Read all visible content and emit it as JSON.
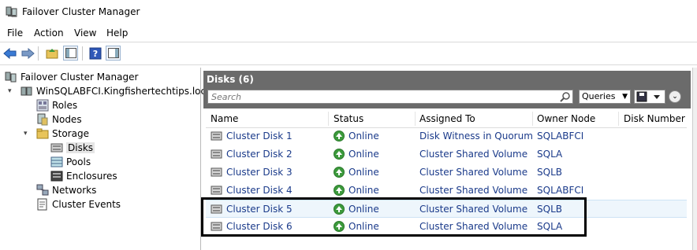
{
  "window": {
    "title": "Failover Cluster Manager"
  },
  "menu": [
    "File",
    "Action",
    "View",
    "Help"
  ],
  "toolbar": {
    "icons": [
      "back-icon",
      "forward-icon",
      "up-folder-icon",
      "show-hide-tree-icon",
      "help-icon",
      "show-hide-action-pane-icon"
    ]
  },
  "tree": {
    "root": "Failover Cluster Manager",
    "cluster": "WinSQLABFCI.Kingfishertechtips.local",
    "roles": "Roles",
    "nodes": "Nodes",
    "storage": "Storage",
    "disks": "Disks",
    "pools": "Pools",
    "enclosures": "Enclosures",
    "networks": "Networks",
    "events": "Cluster Events"
  },
  "pane": {
    "title": "Disks (6)",
    "search_placeholder": "Search",
    "queries_label": "Queries"
  },
  "grid": {
    "columns": [
      "Name",
      "Status",
      "Assigned To",
      "Owner Node",
      "Disk Number"
    ],
    "rows": [
      {
        "name": "Cluster Disk 1",
        "status": "Online",
        "assigned": "Disk Witness in Quorum",
        "owner": "SQLABFCI"
      },
      {
        "name": "Cluster Disk 2",
        "status": "Online",
        "assigned": "Cluster Shared Volume",
        "owner": "SQLA"
      },
      {
        "name": "Cluster Disk 3",
        "status": "Online",
        "assigned": "Cluster Shared Volume",
        "owner": "SQLB"
      },
      {
        "name": "Cluster Disk 4",
        "status": "Online",
        "assigned": "Cluster Shared Volume",
        "owner": "SQLABFCI"
      },
      {
        "name": "Cluster Disk 5",
        "status": "Online",
        "assigned": "Cluster Shared Volume",
        "owner": "SQLB"
      },
      {
        "name": "Cluster Disk 6",
        "status": "Online",
        "assigned": "Cluster Shared Volume",
        "owner": "SQLA"
      }
    ]
  },
  "colors": {
    "link_text": "#1a3a8a",
    "header_bar": "#6b6b6b",
    "status_ok": "#3c9a3c"
  }
}
